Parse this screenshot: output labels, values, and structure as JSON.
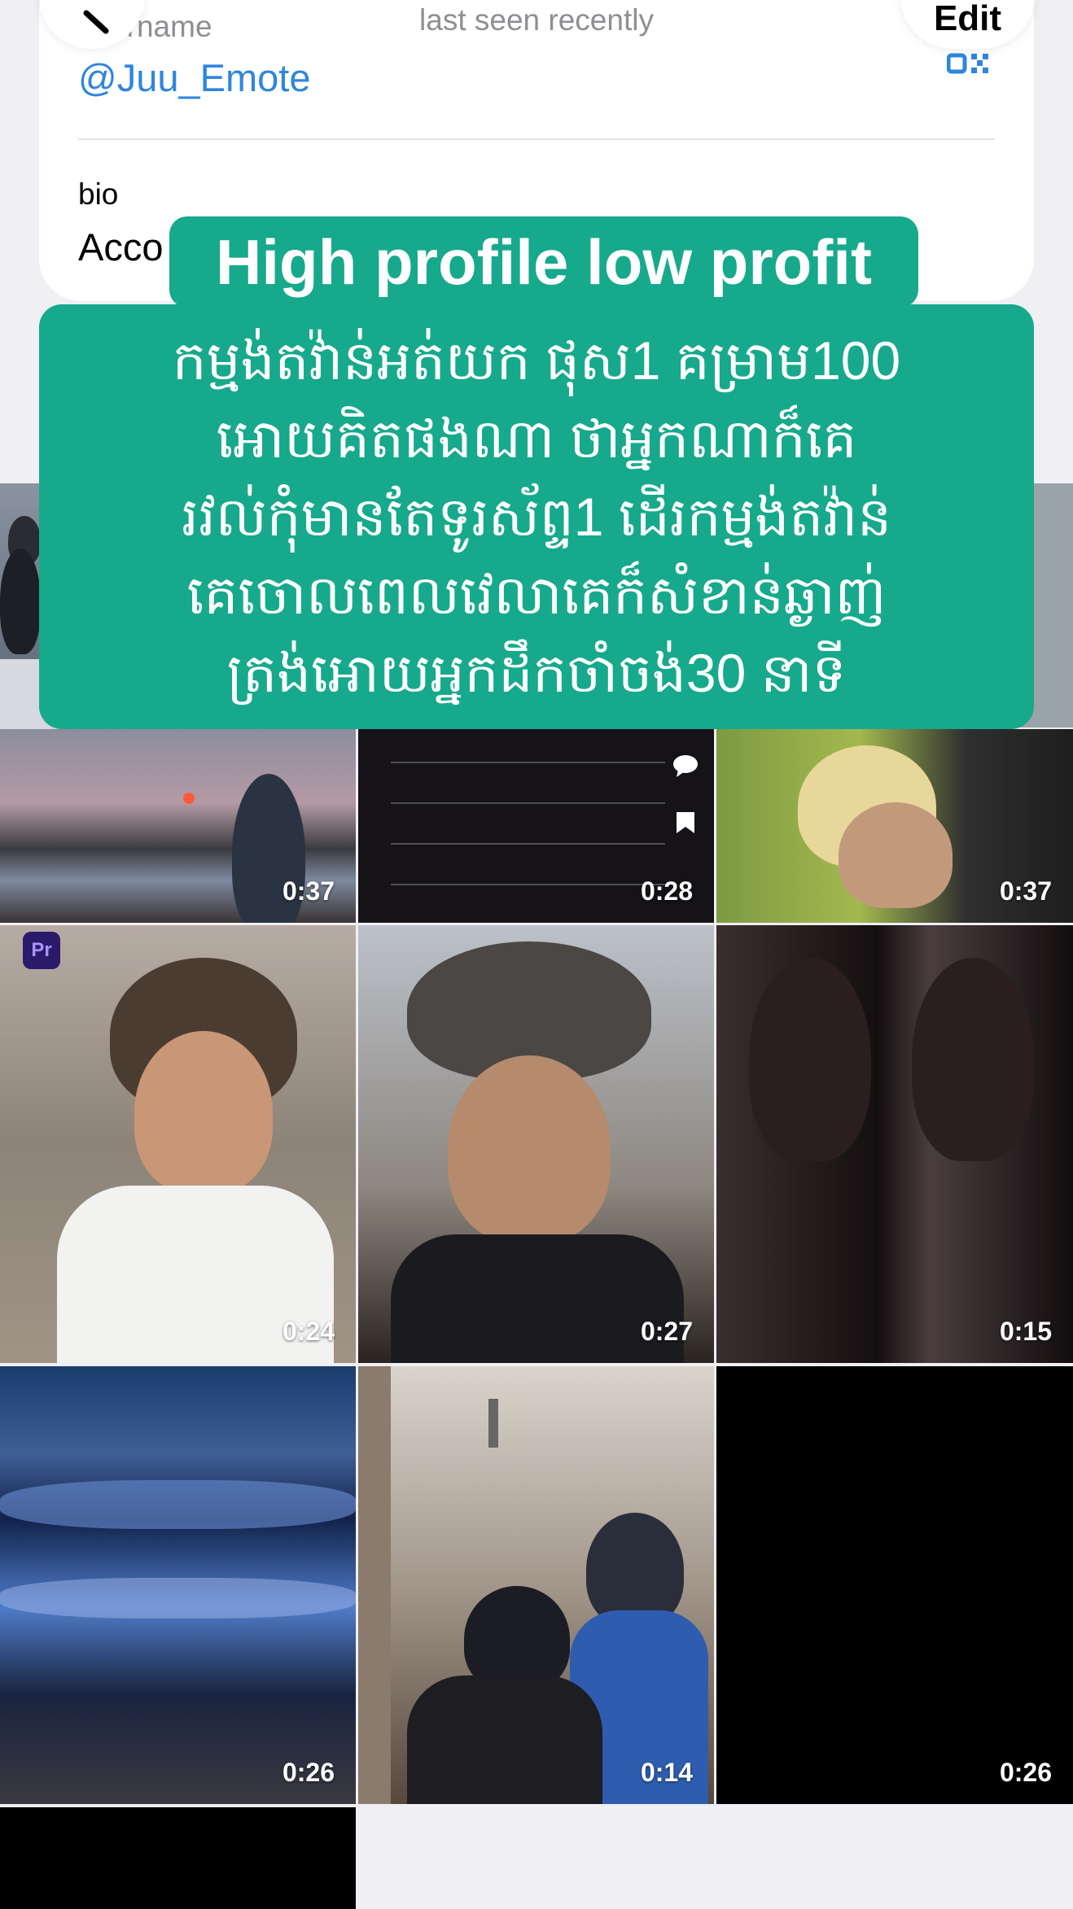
{
  "header": {
    "status": "last seen recently",
    "edit_label": "Edit"
  },
  "profile": {
    "username_label": "username",
    "username": "@Juu_Emote",
    "bio_label": "bio",
    "bio_text": "Acco"
  },
  "overlay": {
    "title": "High profile low profit",
    "lines": [
      "កម្មង់តវ៉ាន់អត់យក ផុស1 គម្រាម100",
      "អោយគិតផងណា ថាអ្នកណាក៏គេ",
      "រវល់កុំមានតែទូរស័ព្ទ1 ដើរកម្មង់តវ៉ាន់",
      "គេចោលពេលវេលាគេក៏សំខាន់ឆ្ងាញ់",
      "ត្រង់អោយអ្នកដឹកចាំចង់30 នាទី"
    ]
  },
  "videos": [
    {
      "duration": "0:37",
      "icon": "sunset-lake"
    },
    {
      "duration": "0:28",
      "icon": "keyboard-screen"
    },
    {
      "duration": "0:37",
      "icon": "blond-selfie"
    },
    {
      "duration": "0:24",
      "icon": "selfie-motorbike",
      "badge": "Pr"
    },
    {
      "duration": "0:27",
      "icon": "cap-selfie"
    },
    {
      "duration": "0:15",
      "icon": "dark-portrait"
    },
    {
      "duration": "0:26",
      "icon": "night-sky"
    },
    {
      "duration": "0:14",
      "icon": "barbershop"
    },
    {
      "duration": "0:26",
      "icon": "black-video"
    }
  ],
  "colors": {
    "accent": "#2f86dc",
    "overlay_green": "#17a98c",
    "background": "#efeff4"
  }
}
